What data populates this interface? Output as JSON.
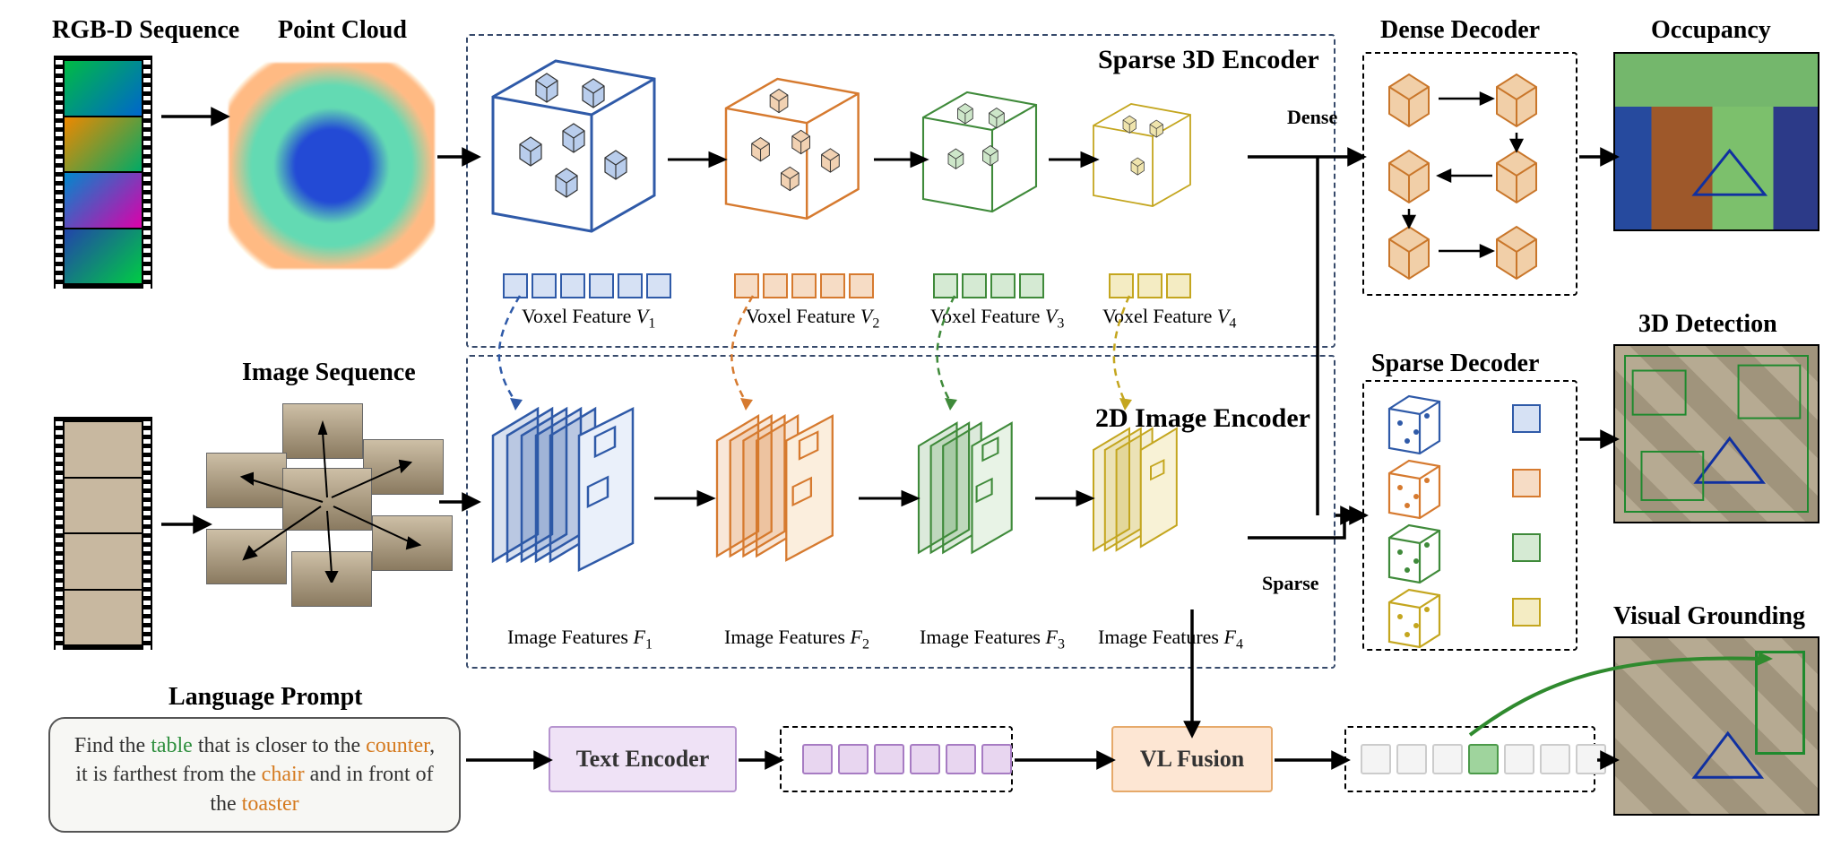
{
  "inputs": {
    "rgbd_label": "RGB-D Sequence",
    "pointcloud_label": "Point Cloud",
    "image_seq_label": "Image Sequence",
    "lang_label": "Language Prompt",
    "lang_parts": {
      "p1": "Find the ",
      "w1": "table",
      "p2": " that is closer to the ",
      "w2": "counter",
      "p3": ", it is farthest from the ",
      "w3": "chair",
      "p4": " and in front of the ",
      "w4": "toaster"
    }
  },
  "encoders": {
    "sparse3d_label": "Sparse 3D Encoder",
    "image2d_label": "2D  Image Encoder",
    "voxel_feature_prefix": "Voxel Feature ",
    "image_feature_prefix": "Image Features ",
    "levels": [
      "V₁",
      "V₂",
      "V₃",
      "V₄"
    ],
    "flevels": [
      "F₁",
      "F₂",
      "F₃",
      "F₄"
    ],
    "colors": {
      "l1": {
        "stroke": "#2f5aa8",
        "fill": "#d6e1f4"
      },
      "l2": {
        "stroke": "#d67a2f",
        "fill": "#f6dcc5"
      },
      "l3": {
        "stroke": "#3f8a3a",
        "fill": "#d5ead3"
      },
      "l4": {
        "stroke": "#c4a61f",
        "fill": "#f4ecc3"
      }
    }
  },
  "paths": {
    "dense_label": "Dense",
    "sparse_label": "Sparse"
  },
  "decoders": {
    "dense_label": "Dense Decoder",
    "sparse_label": "Sparse Decoder"
  },
  "text_branch": {
    "text_encoder_label": "Text Encoder",
    "vl_fusion_label": "VL Fusion"
  },
  "outputs": {
    "occupancy_label": "Occupancy",
    "detection_label": "3D Detection",
    "grounding_label": "Visual Grounding"
  }
}
